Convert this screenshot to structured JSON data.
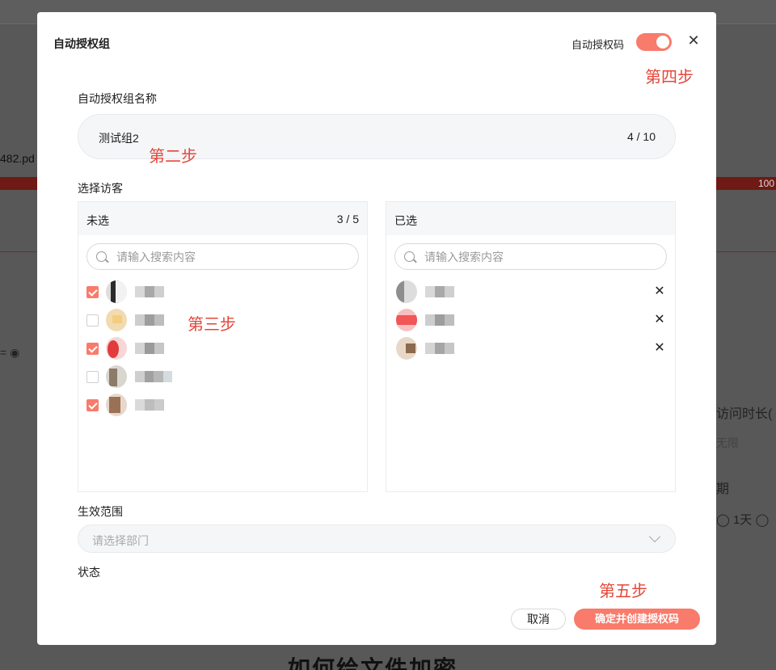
{
  "background": {
    "file_name": "482.pd",
    "progress_text": "100",
    "duration_label": "访问时长(",
    "unlimited_text": "无限",
    "period_label": "期",
    "oneday_text": "◯ 1天 ◯",
    "radio_left_text": "= ◉",
    "page_heading": "如何给文件加密"
  },
  "dialog": {
    "title": "自动授权组",
    "auto_code_label": "自动授权码",
    "auto_code_enabled": true,
    "close_icon": "close-icon"
  },
  "annotations": {
    "step2": "第二步",
    "step3": "第三步",
    "step4": "第四步",
    "step5": "第五步"
  },
  "group_name": {
    "label": "自动授权组名称",
    "value": "测试组2",
    "count": "4 / 10"
  },
  "visitors": {
    "label": "选择访客",
    "unselected": {
      "title": "未选",
      "count": "3 / 5",
      "search_placeholder": "请输入搜索内容",
      "items": [
        {
          "checked": true
        },
        {
          "checked": false
        },
        {
          "checked": true
        },
        {
          "checked": false
        },
        {
          "checked": true
        }
      ]
    },
    "selected": {
      "title": "已选",
      "search_placeholder": "请输入搜索内容",
      "item_count": 3
    }
  },
  "scope": {
    "label": "生效范围",
    "placeholder": "请选择部门"
  },
  "status": {
    "label": "状态"
  },
  "footer": {
    "cancel_label": "取消",
    "confirm_label": "确定并创建授权码"
  },
  "colors": {
    "accent": "#f97b6b",
    "annotation": "#e4473a"
  }
}
